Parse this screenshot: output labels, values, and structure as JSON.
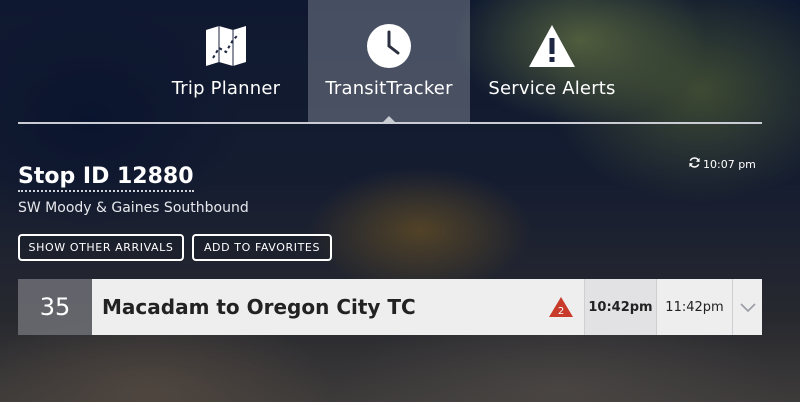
{
  "nav": {
    "tabs": [
      {
        "label": "Trip Planner",
        "icon": "map-icon"
      },
      {
        "label": "TransitTracker",
        "icon": "clock-icon",
        "active": true
      },
      {
        "label": "Service Alerts",
        "icon": "warning-icon"
      }
    ]
  },
  "stop": {
    "title": "Stop ID 12880",
    "subtitle": "SW Moody & Gaines Southbound",
    "updated_time": "10:07 pm"
  },
  "actions": {
    "show_other_arrivals": "SHOW OTHER ARRIVALS",
    "add_to_favorites": "ADD TO FAVORITES"
  },
  "arrivals": [
    {
      "route_number": "35",
      "route_name": "Macadam to Oregon City TC",
      "alert_count": "2",
      "times": [
        "10:42pm",
        "11:42pm"
      ]
    }
  ],
  "colors": {
    "alert_red": "#c83a2a",
    "row_bg": "#eeeeef",
    "route_badge_bg": "#6e7076"
  }
}
